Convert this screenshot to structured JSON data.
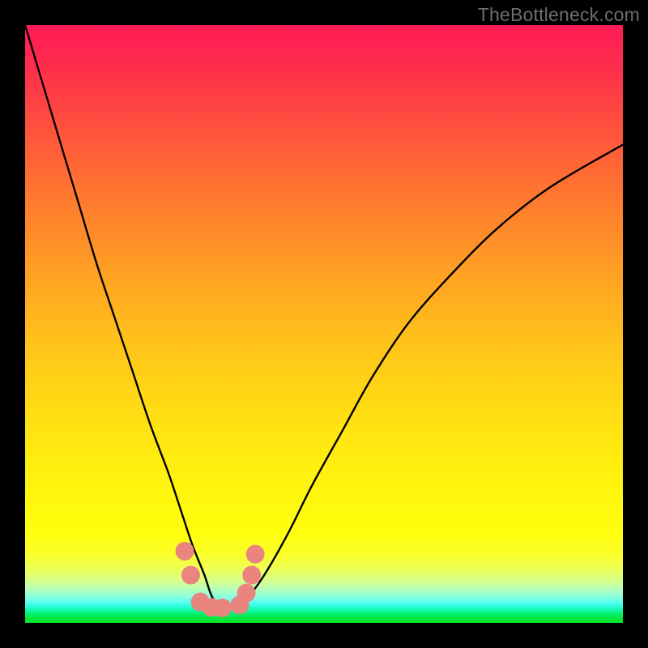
{
  "watermark": "TheBottleneck.com",
  "chart_data": {
    "type": "line",
    "title": "",
    "xlabel": "",
    "ylabel": "",
    "xlim": [
      0,
      100
    ],
    "ylim": [
      0,
      100
    ],
    "grid": false,
    "legend": false,
    "series": [
      {
        "name": "bottleneck-curve",
        "x": [
          0,
          3,
          6,
          9,
          12,
          15,
          18,
          21,
          24,
          26,
          28,
          30,
          31,
          32,
          33.5,
          35,
          37,
          40,
          44,
          48,
          53,
          58,
          64,
          71,
          79,
          88,
          100
        ],
        "y": [
          100,
          90,
          80,
          70,
          60,
          51,
          42,
          33,
          25,
          19,
          13,
          8,
          5,
          3.2,
          2.5,
          2.7,
          4,
          8,
          15,
          23,
          32,
          41,
          50,
          58,
          66,
          73,
          80
        ]
      }
    ],
    "markers": [
      {
        "x": 26.7,
        "y": 12.0
      },
      {
        "x": 27.7,
        "y": 8.0
      },
      {
        "x": 29.3,
        "y": 3.5
      },
      {
        "x": 31.2,
        "y": 2.6
      },
      {
        "x": 33.0,
        "y": 2.5
      },
      {
        "x": 35.9,
        "y": 3.0
      },
      {
        "x": 37.0,
        "y": 5.0
      },
      {
        "x": 37.9,
        "y": 8.0
      },
      {
        "x": 38.5,
        "y": 11.5
      }
    ],
    "marker_color": "#e9857e",
    "curve_color": "#000000",
    "background": "gradient-rainbow-vertical"
  }
}
